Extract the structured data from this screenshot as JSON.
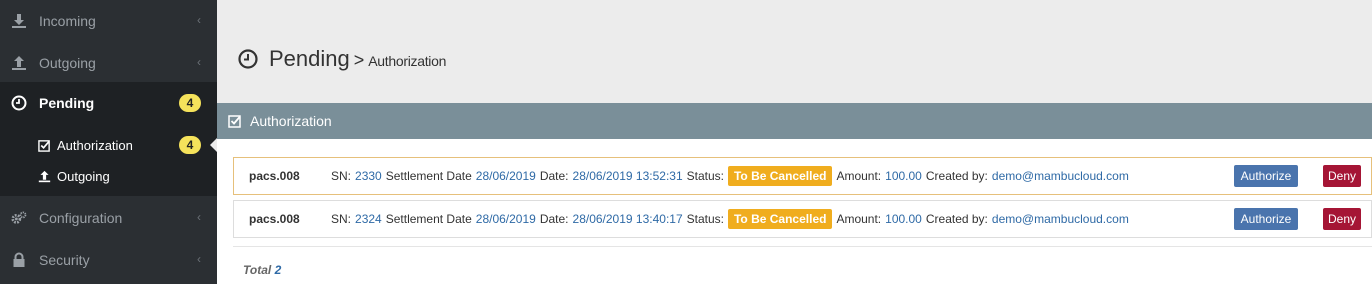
{
  "sidebar": {
    "items": [
      {
        "label": "Incoming",
        "icon": "download-icon"
      },
      {
        "label": "Outgoing",
        "icon": "upload-icon"
      },
      {
        "label": "Pending",
        "icon": "clock-icon",
        "badge": "4"
      },
      {
        "label": "Configuration",
        "icon": "cogs-icon"
      },
      {
        "label": "Security",
        "icon": "lock-icon"
      }
    ],
    "submenu": [
      {
        "label": "Authorization",
        "icon": "check-square-icon",
        "badge": "4"
      },
      {
        "label": "Outgoing",
        "icon": "upload-icon"
      }
    ]
  },
  "page": {
    "title": "Pending",
    "separator": ">",
    "subtitle": "Authorization"
  },
  "panel": {
    "title": "Authorization"
  },
  "rows": [
    {
      "message_type": "pacs.008",
      "sn_label": "SN:",
      "sn": "2330",
      "settlement_label": "Settlement Date",
      "settlement_date": "28/06/2019",
      "date_label": "Date:",
      "date": "28/06/2019 13:52:31",
      "status_label": "Status:",
      "status": "To Be Cancelled",
      "amount_label": "Amount:",
      "amount": "100.00",
      "created_label": "Created by:",
      "created_by": "demo@mambucloud.com",
      "authorize": "Authorize",
      "deny": "Deny"
    },
    {
      "message_type": "pacs.008",
      "sn_label": "SN:",
      "sn": "2324",
      "settlement_label": "Settlement Date",
      "settlement_date": "28/06/2019",
      "date_label": "Date:",
      "date": "28/06/2019 13:40:17",
      "status_label": "Status:",
      "status": "To Be Cancelled",
      "amount_label": "Amount:",
      "amount": "100.00",
      "created_label": "Created by:",
      "created_by": "demo@mambucloud.com",
      "authorize": "Authorize",
      "deny": "Deny"
    }
  ],
  "total": {
    "label": "Total",
    "count": "2"
  },
  "colors": {
    "sidebar_bg": "#2b2f33",
    "active_bg": "#1e2124",
    "badge": "#f5e25b",
    "panel_header": "#7a8f99",
    "status": "#f0ad1e",
    "authorize": "#4a74ad",
    "deny": "#a51535",
    "link": "#2f6aa6"
  }
}
